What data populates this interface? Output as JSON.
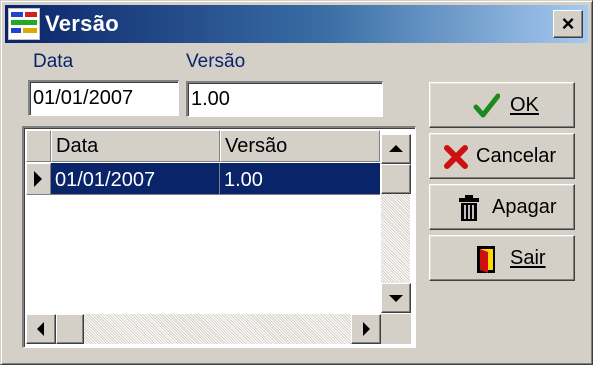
{
  "window": {
    "title": "Versão",
    "close_glyph": "×"
  },
  "form": {
    "data_label": "Data",
    "versao_label": "Versão",
    "data_value": "01/01/2007",
    "versao_value": "1.00"
  },
  "grid": {
    "columns": [
      "Data",
      "Versão"
    ],
    "rows": [
      {
        "data": "01/01/2007",
        "versao": "1.00"
      }
    ]
  },
  "buttons": {
    "ok": {
      "label": "OK",
      "icon": "check-icon"
    },
    "cancelar": {
      "label": "Cancelar",
      "icon": "x-cancel-icon"
    },
    "apagar": {
      "label": "Apagar",
      "icon": "trash-icon"
    },
    "sair": {
      "label": "Sair",
      "icon": "exit-door-icon"
    }
  },
  "colors": {
    "title_bar": "#0a246a",
    "selection": "#0a246a",
    "ok_check": "#1a8a1a",
    "cancel_x": "#cc1111",
    "label_text": "#0a246a"
  }
}
